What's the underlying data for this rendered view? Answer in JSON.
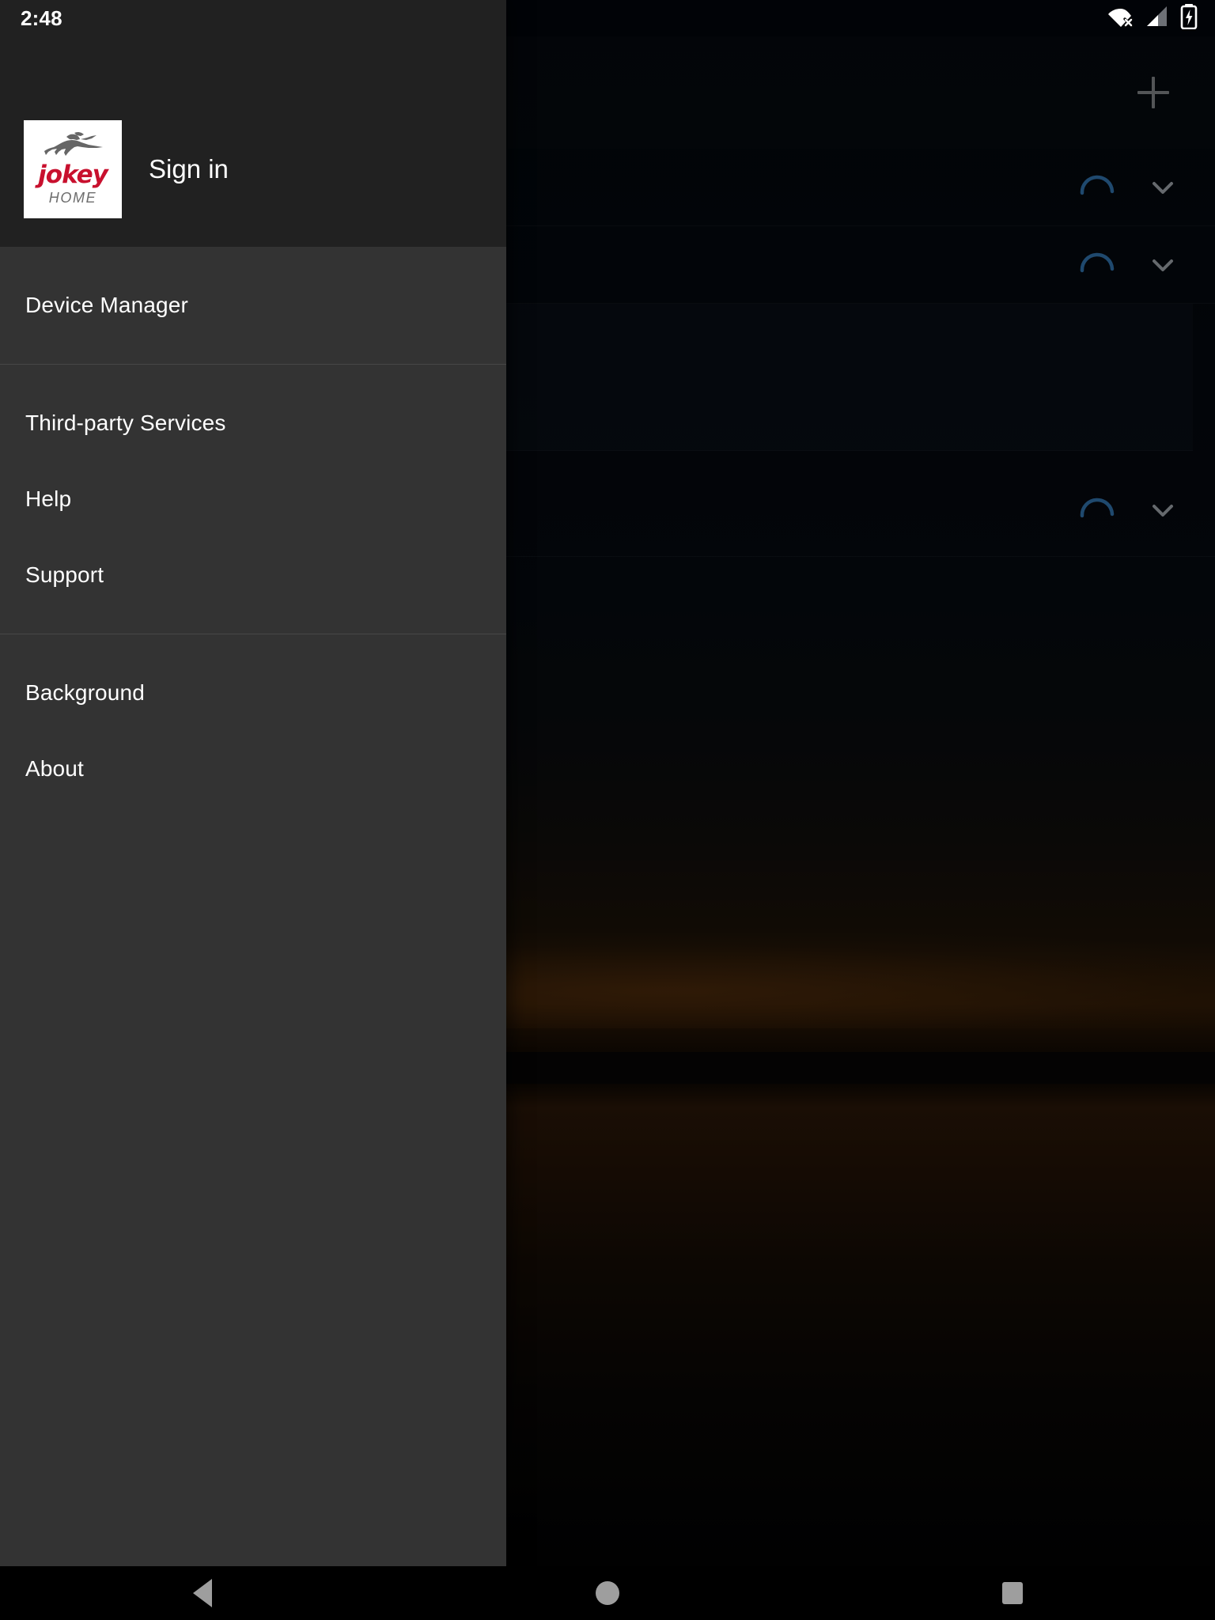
{
  "status_bar": {
    "time": "2:48",
    "icons": [
      {
        "name": "wifi-disconnected-icon",
        "label": "Wi-Fi disconnected"
      },
      {
        "name": "cellular-signal-icon",
        "label": "Mobile signal"
      },
      {
        "name": "battery-charging-icon",
        "label": "Battery charging"
      }
    ]
  },
  "drawer": {
    "account": {
      "sign_in_label": "Sign in",
      "logo": {
        "wordmark": "jokey",
        "subword": "HOME",
        "wordmark_color": "#c8102e",
        "subword_color": "#6d6d6d",
        "tile_color": "#ffffff"
      }
    },
    "groups": [
      {
        "items": [
          {
            "label": "Device Manager",
            "name": "drawer-item-device-manager"
          }
        ]
      },
      {
        "items": [
          {
            "label": "Third-party Services",
            "name": "drawer-item-third-party-services"
          },
          {
            "label": "Help",
            "name": "drawer-item-help"
          },
          {
            "label": "Support",
            "name": "drawer-item-support"
          }
        ]
      },
      {
        "items": [
          {
            "label": "Background",
            "name": "drawer-item-background"
          },
          {
            "label": "About",
            "name": "drawer-item-about"
          }
        ]
      }
    ],
    "background_color": "#333333",
    "header_color": "#212121"
  },
  "app": {
    "add_button_label": "+",
    "rows": [
      {
        "name": "device-row-1",
        "title": "",
        "subtitle": "",
        "status": "loading"
      },
      {
        "name": "device-row-2",
        "title": "",
        "subtitle": "",
        "status": "loading"
      },
      {
        "name": "device-row-3",
        "title": "",
        "subtitle": "",
        "status": "loading"
      }
    ],
    "spinner_color": "#2f6fa8",
    "chevron_color": "#9aa0a6"
  },
  "navigation_bar": {
    "buttons": [
      {
        "name": "nav-back-button",
        "label": "Back"
      },
      {
        "name": "nav-home-button",
        "label": "Home"
      },
      {
        "name": "nav-recents-button",
        "label": "Recents"
      }
    ]
  }
}
